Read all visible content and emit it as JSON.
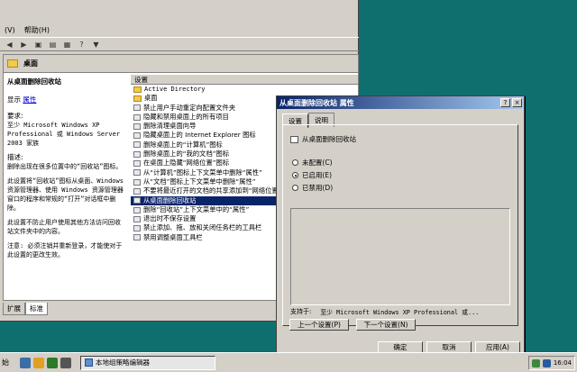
{
  "menubar": {
    "view_label": "(V)",
    "help_label": "帮助(H)"
  },
  "header": {
    "title": "桌面"
  },
  "description": {
    "title": "从桌面删除回收站",
    "display_label": "显示",
    "properties_link": "属性",
    "req_label": "要求:",
    "req_text": "至少 Microsoft Windows XP Professional 或 Windows Server 2003 家族",
    "desc_label": "描述:",
    "desc_text": "删除出现在很多位置中的“回收站”图标。",
    "para1": "此设置将“回收站”图标从桌面、Windows 资源管理器、使用 Windows 资源管理器窗口的程序和常规的“打开”对话框中删除。",
    "para2": "此设置不防止用户使用其他方法访问回收站文件夹中的内容。",
    "para3": "注意: 必须注销并重新登录，才能使对于此设置的更改生效。"
  },
  "list": {
    "header": "设置",
    "rows": [
      {
        "label": "Active Directory",
        "kind": "folder"
      },
      {
        "label": "桌面",
        "kind": "folder"
      },
      {
        "label": "禁止用户手动重定向配置文件夹",
        "kind": "item"
      },
      {
        "label": "隐藏和禁用桌面上的所有项目",
        "kind": "item"
      },
      {
        "label": "删除清理桌面向导",
        "kind": "item"
      },
      {
        "label": "隐藏桌面上的 Internet Explorer 图标",
        "kind": "item"
      },
      {
        "label": "删除桌面上的“计算机”图标",
        "kind": "item"
      },
      {
        "label": "删除桌面上的“我的文档”图标",
        "kind": "item"
      },
      {
        "label": "在桌面上隐藏“网络位置”图标",
        "kind": "item"
      },
      {
        "label": "从“计算机”图标上下文菜单中删除“属性”",
        "kind": "item"
      },
      {
        "label": "从“文档”图标上下文菜单中删除“属性”",
        "kind": "item"
      },
      {
        "label": "不要将最近打开的文档的共享添加到“网络位置”",
        "kind": "item"
      },
      {
        "label": "从桌面删除回收站",
        "kind": "item",
        "selected": true
      },
      {
        "label": "删除“回收站”上下文菜单中的“属性”",
        "kind": "item"
      },
      {
        "label": "退出时不保存设置",
        "kind": "item"
      },
      {
        "label": "禁止添加、拖、放和关闭任务栏的工具栏",
        "kind": "item"
      },
      {
        "label": "禁用调整桌面工具栏",
        "kind": "item"
      }
    ]
  },
  "tabs": {
    "extended": "扩展",
    "standard": "标准"
  },
  "dialog": {
    "title": "从桌面删除回收站 属性",
    "help_btn": "?",
    "close_btn": "×",
    "tab_setting": "设置",
    "tab_explain": "说明",
    "setting_name": "从桌面删除回收站",
    "radio_not_configured": "未配置(C)",
    "radio_enabled": "已启用(E)",
    "radio_disabled": "已禁用(D)",
    "support_label": "支持于:",
    "support_value": "至少 Microsoft Windows XP Professional 或...",
    "prev_btn": "上一个设置(P)",
    "next_btn": "下一个设置(N)",
    "ok_btn": "确定",
    "cancel_btn": "取消",
    "apply_btn": "应用(A)"
  },
  "taskbar": {
    "start_label": "始",
    "task_label": "本地组策略编辑器",
    "clock": "16:04"
  }
}
